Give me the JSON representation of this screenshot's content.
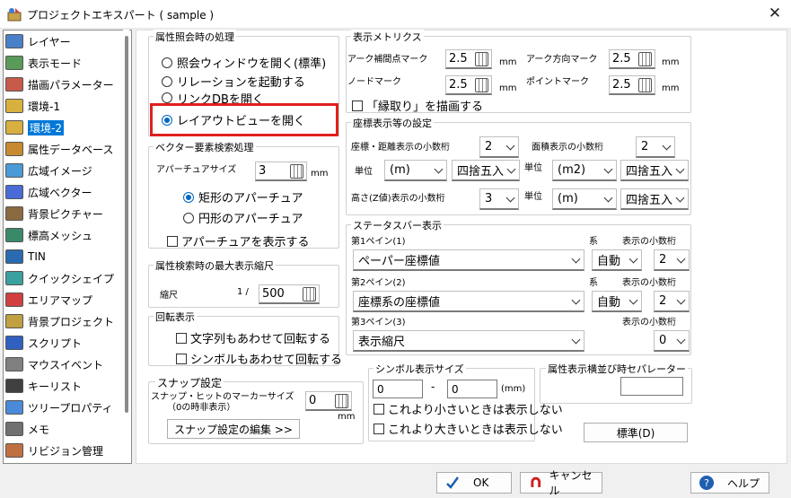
{
  "window": {
    "title": "プロジェクトエキスパート ( sample )",
    "close": "✕"
  },
  "sidebar": {
    "items": [
      {
        "label": "レイヤー"
      },
      {
        "label": "表示モード"
      },
      {
        "label": "描画パラメーター"
      },
      {
        "label": "環境-1"
      },
      {
        "label": "環境-2",
        "selected": true
      },
      {
        "label": "属性データベース"
      },
      {
        "label": "広域イメージ"
      },
      {
        "label": "広域ベクター"
      },
      {
        "label": "背景ピクチャー"
      },
      {
        "label": "標高メッシュ"
      },
      {
        "label": "TIN"
      },
      {
        "label": "クイックシェイプ"
      },
      {
        "label": "エリアマップ"
      },
      {
        "label": "背景プロジェクト"
      },
      {
        "label": "スクリプト"
      },
      {
        "label": "マウスイベント"
      },
      {
        "label": "キーリスト"
      },
      {
        "label": "ツリープロパティ"
      },
      {
        "label": "メモ"
      },
      {
        "label": "リビジョン管理"
      }
    ]
  },
  "attr_query": {
    "title": "属性照会時の処理",
    "options": [
      "照会ウィンドウを開く(標準)",
      "リレーションを起動する",
      "リンクDBを開く",
      "レイアウトビューを開く"
    ],
    "selected": 3
  },
  "vector_search": {
    "title": "ベクター要素検索処理",
    "aperture_label": "アパーチュアサイズ",
    "aperture_value": "3",
    "aperture_unit": "mm",
    "shapes": [
      "矩形のアパーチュア",
      "円形のアパーチュア"
    ],
    "shape_selected": 0,
    "show_aperture": "アパーチュアを表示する"
  },
  "max_scale": {
    "title": "属性検索時の最大表示縮尺",
    "label": "縮尺",
    "prefix": "1 /",
    "value": "500"
  },
  "rotation": {
    "title": "回転表示",
    "text_rotate": "文字列もあわせて回転する",
    "symbol_rotate": "シンボルもあわせて回転する"
  },
  "snap": {
    "title": "スナップ設定",
    "marker_label": "スナップ・ヒットのマーカーサイズ",
    "marker_note": "（0の時非表示）",
    "marker_value": "0",
    "marker_unit": "mm",
    "edit_button": "スナップ設定の編集 >>"
  },
  "metrics": {
    "title": "表示メトリクス",
    "arc_interp_label": "アーク補間点マーク",
    "arc_interp_value": "2.5",
    "arc_dir_label": "アーク方向マーク",
    "arc_dir_value": "2.5",
    "node_label": "ノードマーク",
    "node_value": "2.5",
    "point_label": "ポイントマーク",
    "point_value": "2.5",
    "unit": "mm",
    "edge_check": "「縁取り」を描画する"
  },
  "coord": {
    "title": "座標表示等の設定",
    "coord_dec_label": "座標・距離表示の小数桁",
    "coord_dec_value": "2",
    "area_dec_label": "面積表示の小数桁",
    "area_dec_value": "2",
    "unit_label": "単位",
    "coord_unit": "(m)",
    "coord_round": "四捨五入",
    "area_unit": "(m2)",
    "area_round": "四捨五入",
    "z_dec_label": "高さ(Z値)表示の小数桁",
    "z_dec_value": "3",
    "z_unit": "(m)",
    "z_round": "四捨五入"
  },
  "statusbar": {
    "title": "ステータスバー表示",
    "sys_label": "系",
    "dec_label": "表示の小数桁",
    "panes": [
      {
        "label": "第1ペイン(1)",
        "value": "ペーパー座標値",
        "sys": "自動",
        "dec": "2"
      },
      {
        "label": "第2ペイン(2)",
        "value": "座標系の座標値",
        "sys": "自動",
        "dec": "2"
      },
      {
        "label": "第3ペイン(3)",
        "value": "表示縮尺",
        "dec": "0"
      }
    ]
  },
  "symbol_size": {
    "title": "シンボル表示サイズ",
    "min": "0",
    "dash": "-",
    "max": "0",
    "unit": "(mm)",
    "hide_small": "これより小さいときは表示しない",
    "hide_large": "これより大きいときは表示しない"
  },
  "separator": {
    "title": "属性表示横並び時セパレーター",
    "value": ""
  },
  "standard_button": "標準(D)",
  "buttons": {
    "ok": "OK",
    "cancel": "キャンセル",
    "help": "ヘルプ"
  }
}
